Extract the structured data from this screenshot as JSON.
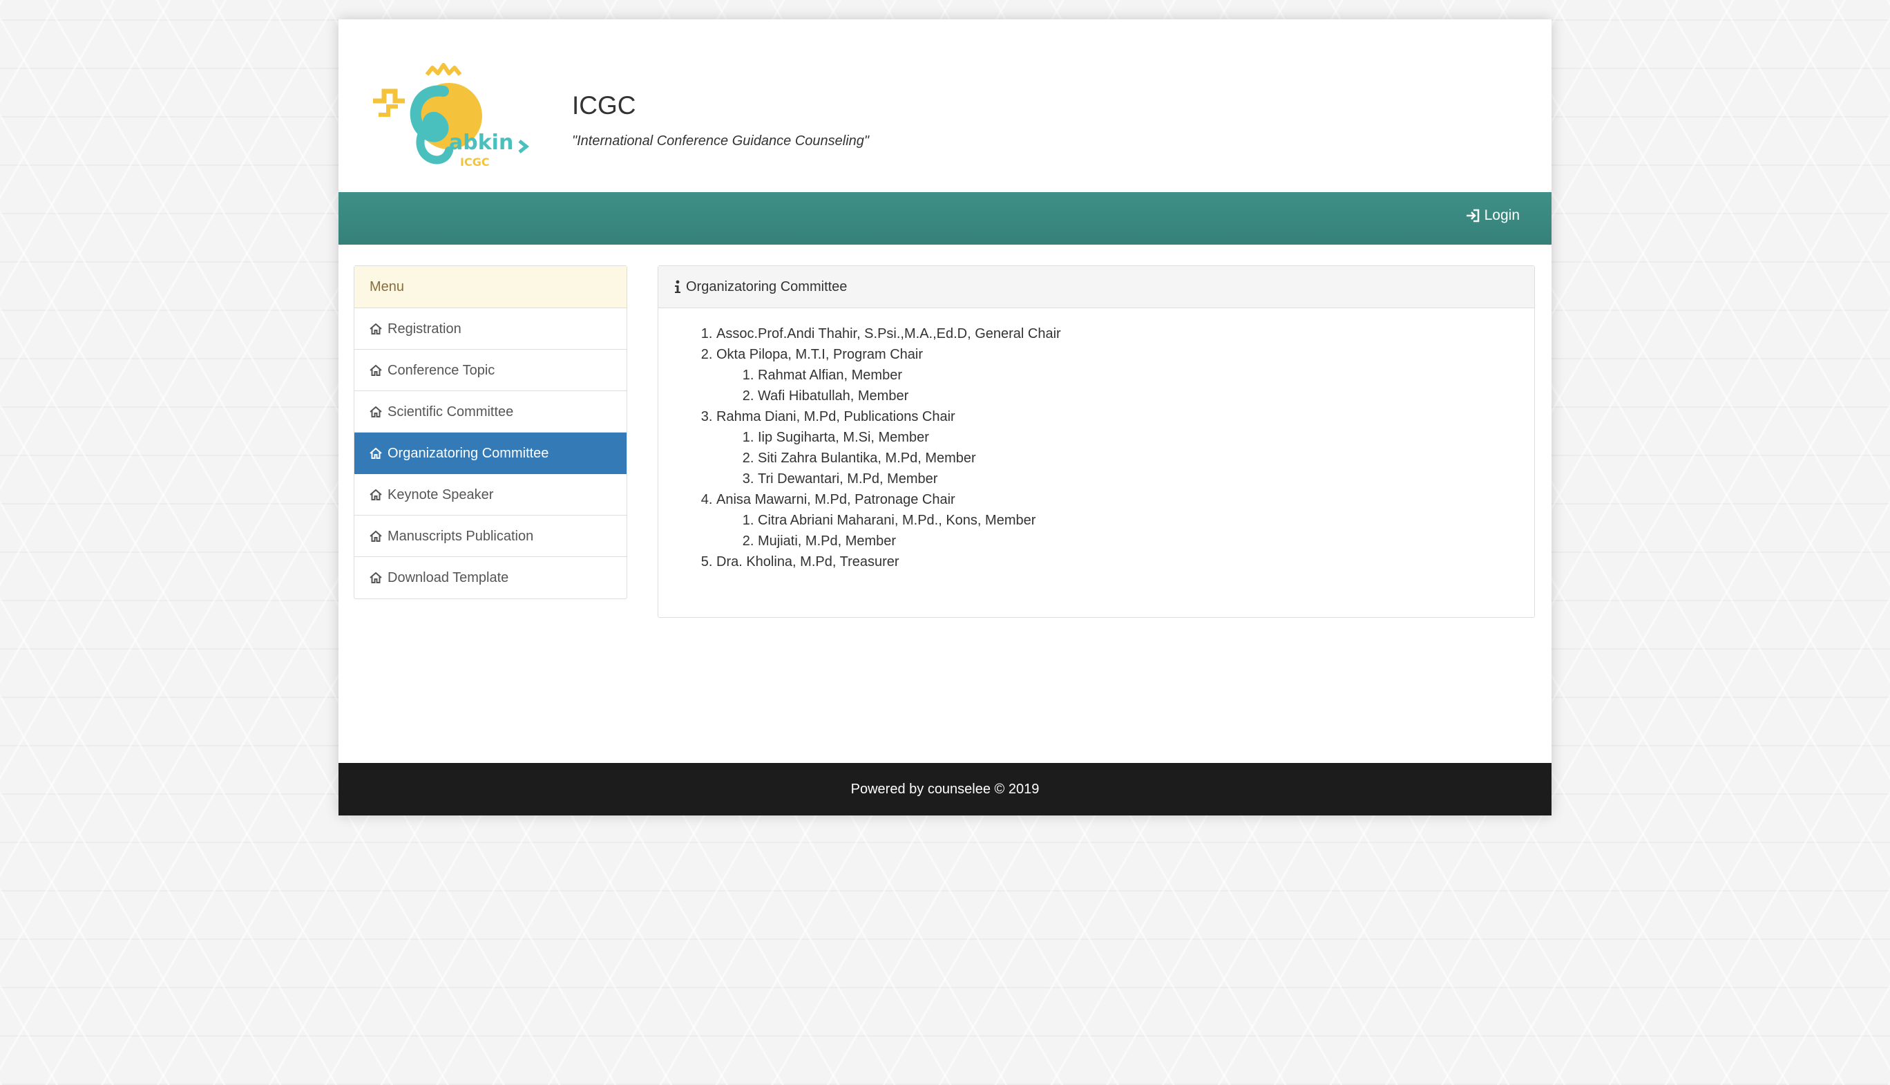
{
  "site": {
    "title": "ICGC",
    "tagline": "\"International Conference Guidance Counseling\""
  },
  "navbar": {
    "login_label": "Login",
    "bar_color": "#3a8b83"
  },
  "sidebar": {
    "heading": "Menu",
    "items": [
      {
        "label": "Registration",
        "active": false
      },
      {
        "label": "Conference Topic",
        "active": false
      },
      {
        "label": "Scientific Committee",
        "active": false
      },
      {
        "label": "Organizatoring Committee",
        "active": true
      },
      {
        "label": "Keynote Speaker",
        "active": false
      },
      {
        "label": "Manuscripts Publication",
        "active": false
      },
      {
        "label": "Download Template",
        "active": false
      }
    ]
  },
  "panel": {
    "title": "Organizatoring Committee",
    "committee": [
      {
        "text": "Assoc.Prof.Andi Thahir, S.Psi.,M.A.,Ed.D, General Chair",
        "members": []
      },
      {
        "text": "Okta Pilopa, M.T.I, Program Chair",
        "members": [
          "Rahmat Alfian, Member",
          "Wafi Hibatullah, Member"
        ]
      },
      {
        "text": "Rahma Diani, M.Pd, Publications Chair",
        "members": [
          "Iip Sugiharta, M.Si, Member",
          "Siti Zahra Bulantika, M.Pd, Member",
          "Tri Dewantari, M.Pd, Member"
        ]
      },
      {
        "text": "Anisa Mawarni, M.Pd, Patronage Chair",
        "members": [
          "Citra Abriani Maharani, M.Pd., Kons, Member",
          "Mujiati, M.Pd, Member"
        ]
      },
      {
        "text": "Dra. Kholina, M.Pd, Treasurer",
        "members": []
      }
    ]
  },
  "footer": {
    "text": "Powered by counselee © 2019"
  },
  "icons": {
    "menu_item": "home-icon",
    "panel_title": "info-icon",
    "login": "sign-in-icon"
  },
  "colors": {
    "accent": "#337ab7",
    "menu_header_bg": "#fcf8e3",
    "footer_bg": "#1c1c1c"
  }
}
